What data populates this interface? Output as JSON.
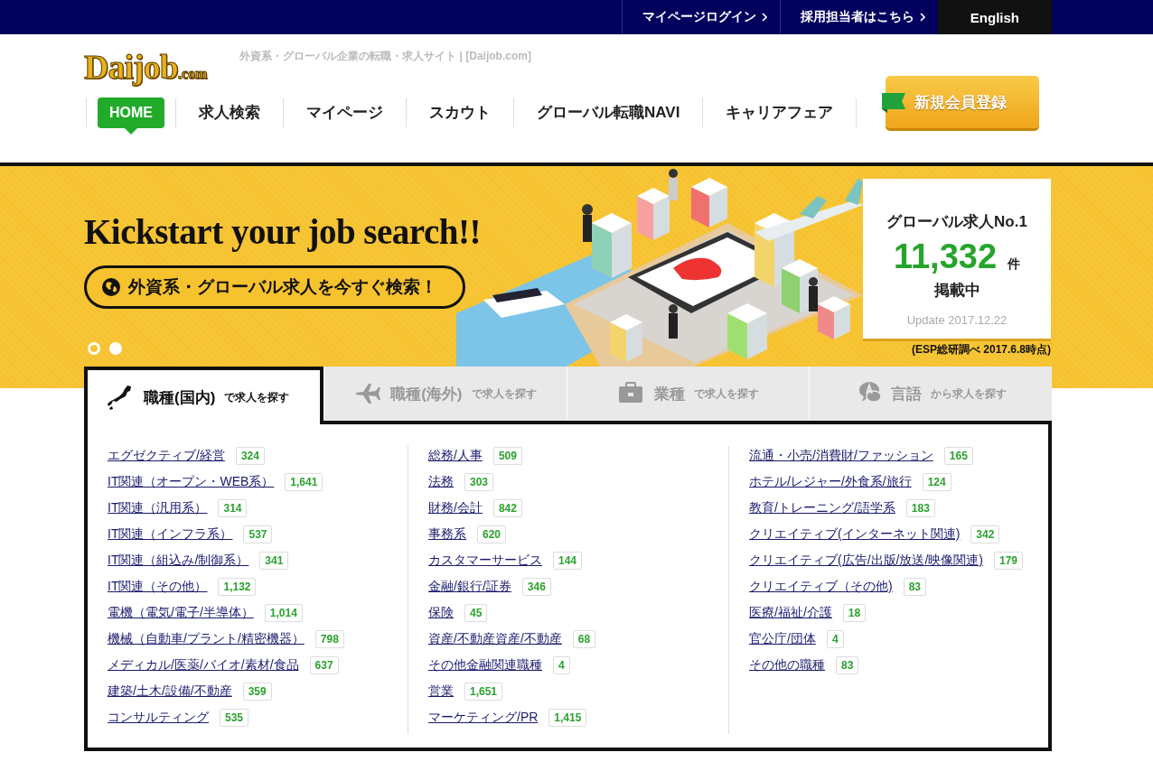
{
  "top_bar": {
    "links": [
      {
        "label": "マイページログイン",
        "kind": "chevron"
      },
      {
        "label": "採用担当者はこちら",
        "kind": "chevron"
      },
      {
        "label": "English",
        "kind": "dark"
      }
    ]
  },
  "header": {
    "logo": {
      "name": "Daijob",
      "suffix": ".com"
    },
    "tagline": "外資系・グローバル企業の転職・求人サイト | [Daijob.com]",
    "nav": [
      {
        "label": "HOME",
        "selected": true
      },
      {
        "label": "求人検索",
        "selected": false
      },
      {
        "label": "マイページ",
        "selected": false
      },
      {
        "label": "スカウト",
        "selected": false
      },
      {
        "label": "グローバル転職NAVI",
        "selected": false
      },
      {
        "label": "キャリアフェア",
        "selected": false
      }
    ],
    "signup_button": "新規会員登録"
  },
  "banner": {
    "headline": "Kickstart your job search!!",
    "search_button": "外資系・グローバル求人を今すぐ検索！",
    "stats": {
      "title": "グローバル求人No.1",
      "count": "11,332",
      "unit": "件",
      "caption": "掲載中",
      "update": "Update 2017.12.22"
    },
    "footnote": "(ESP総研調べ 2017.6.8時点)",
    "slides": [
      {
        "selected": true
      },
      {
        "selected": false
      }
    ]
  },
  "search_tabs": [
    {
      "title": "職種(国内)",
      "suffix": "で求人を探す",
      "kind": "japan",
      "selected": true
    },
    {
      "title": "職種(海外)",
      "suffix": "で求人を探す",
      "kind": "plane",
      "selected": false
    },
    {
      "title": "業種",
      "suffix": "で求人を探す",
      "kind": "briefcase",
      "selected": false
    },
    {
      "title": "言語",
      "suffix": "から求人を探す",
      "kind": "speech",
      "selected": false
    }
  ],
  "categories": [
    [
      {
        "label": "エグゼクティブ/経営",
        "count": "324"
      },
      {
        "label": "IT関連（オープン・WEB系）",
        "count": "1,641"
      },
      {
        "label": "IT関連（汎用系）",
        "count": "314"
      },
      {
        "label": "IT関連（インフラ系）",
        "count": "537"
      },
      {
        "label": "IT関連（組込み/制御系）",
        "count": "341"
      },
      {
        "label": "IT関連（その他）",
        "count": "1,132"
      },
      {
        "label": "電機（電気/電子/半導体）",
        "count": "1,014"
      },
      {
        "label": "機械（自動車/プラント/精密機器）",
        "count": "798"
      },
      {
        "label": "メディカル/医薬/バイオ/素材/食品",
        "count": "637"
      },
      {
        "label": "建築/土木/設備/不動産",
        "count": "359"
      },
      {
        "label": "コンサルティング",
        "count": "535"
      }
    ],
    [
      {
        "label": "総務/人事",
        "count": "509"
      },
      {
        "label": "法務",
        "count": "303"
      },
      {
        "label": "財務/会計",
        "count": "842"
      },
      {
        "label": "事務系",
        "count": "620"
      },
      {
        "label": "カスタマーサービス",
        "count": "144"
      },
      {
        "label": "金融/銀行/証券",
        "count": "346"
      },
      {
        "label": "保険",
        "count": "45"
      },
      {
        "label": "資産/不動産資産/不動産",
        "count": "68"
      },
      {
        "label": "その他金融関連職種",
        "count": "4"
      },
      {
        "label": "営業",
        "count": "1,651"
      },
      {
        "label": "マーケティング/PR",
        "count": "1,415"
      }
    ],
    [
      {
        "label": "流通・小売/消費財/ファッション",
        "count": "165"
      },
      {
        "label": "ホテル/レジャー/外食系/旅行",
        "count": "124"
      },
      {
        "label": "教育/トレーニング/語学系",
        "count": "183"
      },
      {
        "label": "クリエイティブ(インターネット関連)",
        "count": "342"
      },
      {
        "label": "クリエイティブ(広告/出版/放送/映像関連)",
        "count": "179"
      },
      {
        "label": "クリエイティブ（その他)",
        "count": "83"
      },
      {
        "label": "医療/福祉/介護",
        "count": "18"
      },
      {
        "label": "官公庁/団体",
        "count": "4"
      },
      {
        "label": "その他の職種",
        "count": "83"
      }
    ]
  ]
}
